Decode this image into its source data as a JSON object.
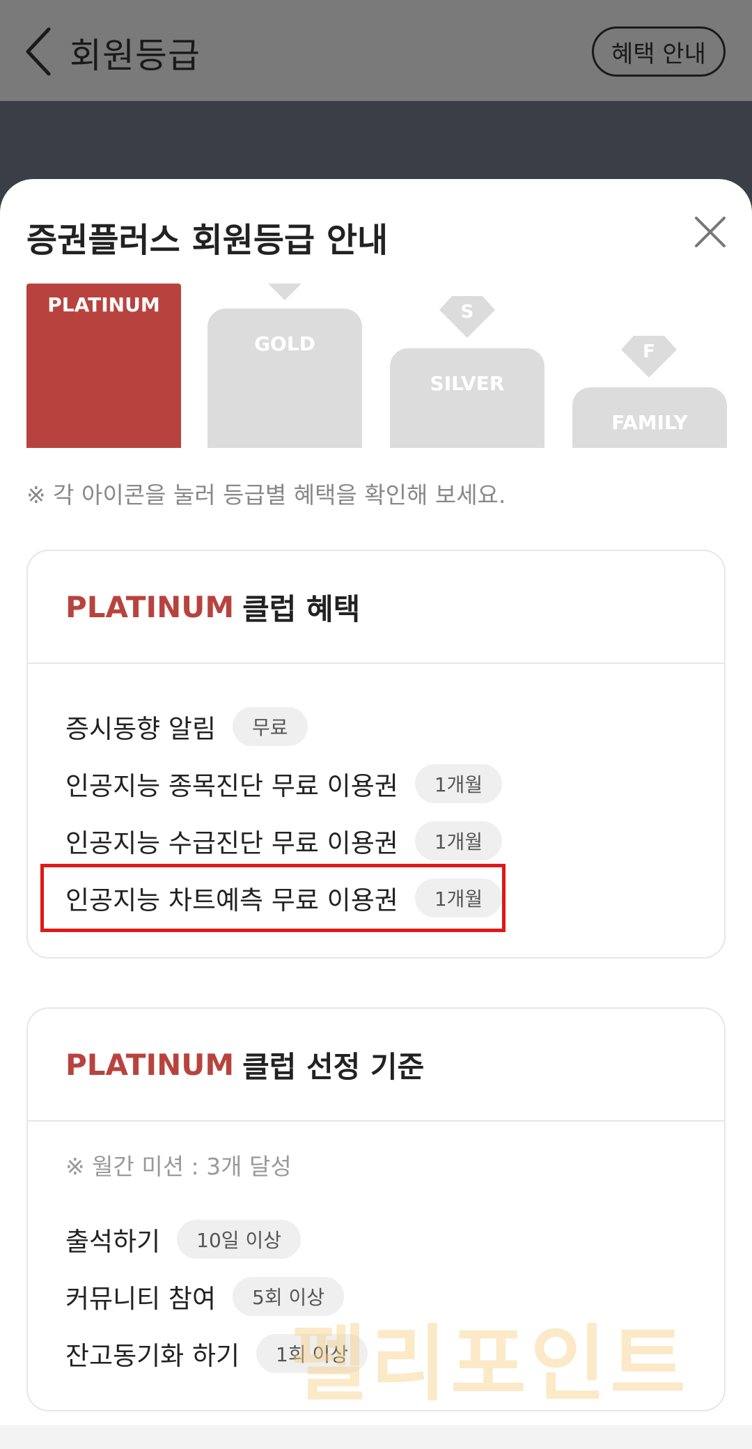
{
  "header": {
    "title": "회원등급",
    "benefit_button": "혜택 안내"
  },
  "sheet": {
    "title": "증권플러스 회원등급 안내",
    "grades": [
      {
        "label": "PLATINUM",
        "selected": true
      },
      {
        "label": "GOLD",
        "selected": false
      },
      {
        "label": "SILVER",
        "selected": false,
        "badge": "S"
      },
      {
        "label": "FAMILY",
        "selected": false,
        "badge": "F"
      }
    ],
    "hint": "※ 각 아이콘을 눌러 등급별 혜택을 확인해 보세요."
  },
  "benefits_card": {
    "grade_name": "PLATINUM",
    "title_suffix": "클럽 혜택",
    "rows": [
      {
        "name": "증시동향 알림",
        "chip": "무료"
      },
      {
        "name": "인공지능 종목진단 무료 이용권",
        "chip": "1개월"
      },
      {
        "name": "인공지능 수급진단 무료 이용권",
        "chip": "1개월"
      },
      {
        "name": "인공지능 차트예측 무료 이용권",
        "chip": "1개월"
      }
    ]
  },
  "criteria_card": {
    "grade_name": "PLATINUM",
    "title_suffix": "클럽 선정 기준",
    "note": "※ 월간 미션 : 3개 달성",
    "rows": [
      {
        "name": "출석하기",
        "chip": "10일 이상"
      },
      {
        "name": "커뮤니티 참여",
        "chip": "5회 이상"
      },
      {
        "name": "잔고동기화 하기",
        "chip": "1회 이상"
      }
    ]
  },
  "watermark": "펠리포인트",
  "colors": {
    "accent": "#b8433e",
    "highlight": "#e01818",
    "inactive_grade": "#dcdcdc"
  }
}
